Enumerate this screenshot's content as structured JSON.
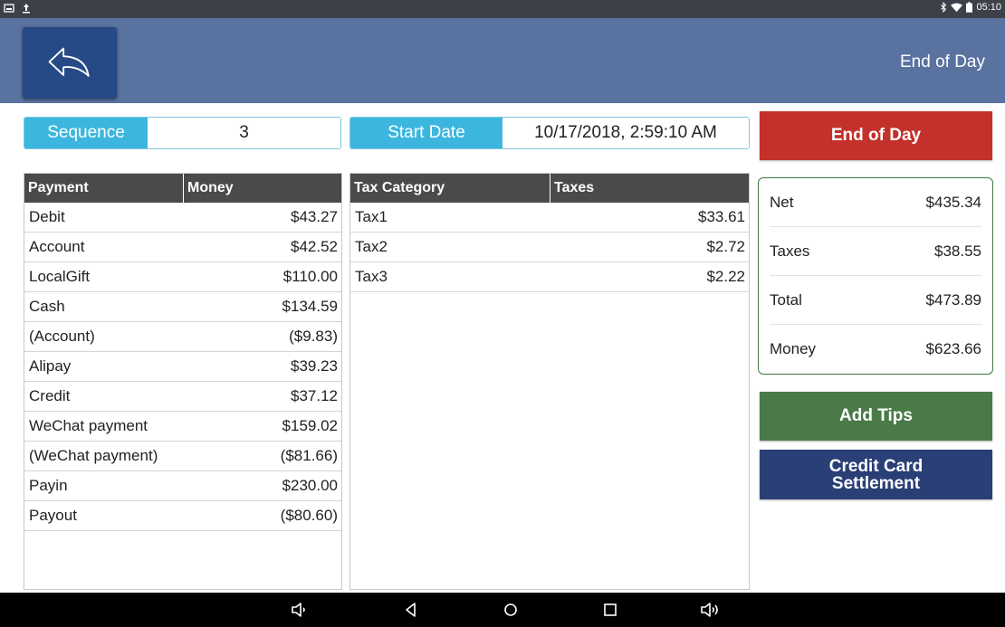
{
  "status_bar": {
    "time": "05:10",
    "left_icons": [
      "photo-icon",
      "upload-icon"
    ],
    "right_icons": [
      "bluetooth-icon",
      "wifi-icon",
      "battery-icon"
    ]
  },
  "header": {
    "title": "End of Day",
    "back_icon": "back-arrow-icon"
  },
  "fields": {
    "sequence_label": "Sequence",
    "sequence_value": "3",
    "start_date_label": "Start Date",
    "start_date_value": "10/17/2018, 2:59:10 AM"
  },
  "payments": {
    "headers": [
      "Payment",
      "Money"
    ],
    "rows": [
      {
        "name": "Debit",
        "amount": "$43.27"
      },
      {
        "name": "Account",
        "amount": "$42.52"
      },
      {
        "name": "LocalGift",
        "amount": "$110.00"
      },
      {
        "name": "Cash",
        "amount": "$134.59"
      },
      {
        "name": "(Account)",
        "amount": "($9.83)"
      },
      {
        "name": "Alipay",
        "amount": "$39.23"
      },
      {
        "name": "Credit",
        "amount": "$37.12"
      },
      {
        "name": "WeChat payment",
        "amount": "$159.02"
      },
      {
        "name": "(WeChat payment)",
        "amount": "($81.66)"
      },
      {
        "name": "Payin",
        "amount": "$230.00"
      },
      {
        "name": "Payout",
        "amount": "($80.60)"
      }
    ]
  },
  "taxes": {
    "headers": [
      "Tax Category",
      "Taxes"
    ],
    "rows": [
      {
        "name": "Tax1",
        "amount": "$33.61"
      },
      {
        "name": "Tax2",
        "amount": "$2.72"
      },
      {
        "name": "Tax3",
        "amount": "$2.22"
      }
    ]
  },
  "actions": {
    "end_of_day": "End of Day",
    "add_tips": "Add Tips",
    "credit_card_settlement": "Credit Card Settlement"
  },
  "summary": [
    {
      "label": "Net",
      "value": "$435.34"
    },
    {
      "label": "Taxes",
      "value": "$38.55"
    },
    {
      "label": "Total",
      "value": "$473.89"
    },
    {
      "label": "Money",
      "value": "$623.66"
    }
  ],
  "nav_bar": {
    "icons": [
      "volume-down-icon",
      "back-triangle-icon",
      "home-circle-icon",
      "recents-square-icon",
      "volume-up-icon"
    ]
  },
  "colors": {
    "header": "#5a72a0",
    "back_button": "#264a86",
    "field_label": "#3cb6df",
    "table_header": "#4a4a4a",
    "end_of_day": "#c4302b",
    "add_tips": "#4a7a48",
    "credit_card": "#2a3f75",
    "summary_border": "#3c7a3c"
  }
}
